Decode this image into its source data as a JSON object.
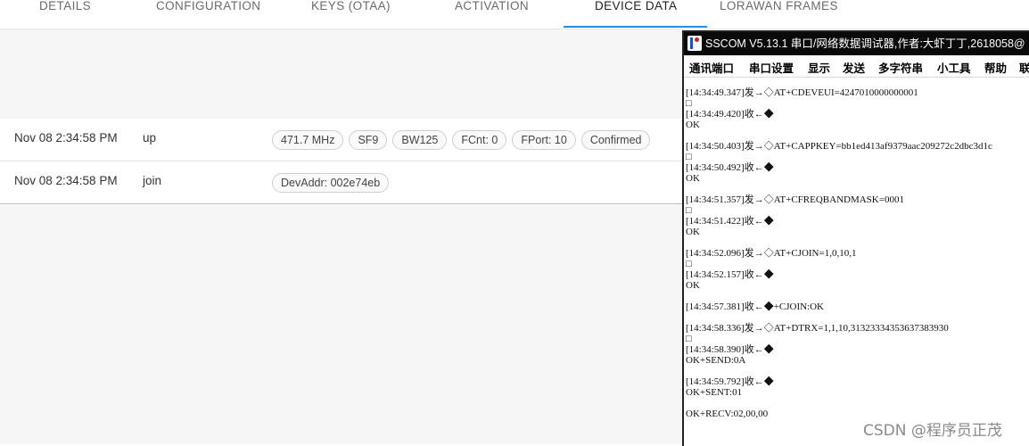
{
  "tabs": [
    {
      "label": "DETAILS"
    },
    {
      "label": "CONFIGURATION"
    },
    {
      "label": "KEYS (OTAA)"
    },
    {
      "label": "ACTIVATION"
    },
    {
      "label": "DEVICE DATA"
    },
    {
      "label": "LORAWAN FRAMES"
    }
  ],
  "active_tab": "DEVICE DATA",
  "accent_color": "#1890ff",
  "frames": [
    {
      "time": "Nov 08 2:34:58 PM",
      "type": "up",
      "tags": [
        "471.7 MHz",
        "SF9",
        "BW125",
        "FCnt: 0",
        "FPort: 10",
        "Confirmed"
      ]
    },
    {
      "time": "Nov 08 2:34:58 PM",
      "type": "join",
      "tags": [
        "DevAddr: 002e74eb"
      ]
    }
  ],
  "sscom": {
    "title": "SSCOM V5.13.1 串口/网络数据调试器,作者:大虾丁丁,2618058@",
    "menu": [
      "通讯端口",
      "串口设置",
      "显示",
      "发送",
      "多字符串",
      "小工具",
      "帮助",
      "联"
    ],
    "log": [
      "[14:34:49.347]发→◇AT+CDEVEUI=4247010000000001",
      "□",
      "[14:34:49.420]收←◆",
      "OK",
      "",
      "[14:34:50.403]发→◇AT+CAPPKEY=bb1ed413af9379aac209272c2dbc3d1c",
      "□",
      "[14:34:50.492]收←◆",
      "OK",
      "",
      "[14:34:51.357]发→◇AT+CFREQBANDMASK=0001",
      "□",
      "[14:34:51.422]收←◆",
      "OK",
      "",
      "[14:34:52.096]发→◇AT+CJOIN=1,0,10,1",
      "□",
      "[14:34:52.157]收←◆",
      "OK",
      "",
      "[14:34:57.381]收←◆+CJOIN:OK",
      "",
      "[14:34:58.336]发→◇AT+DTRX=1,1,10,31323334353637383930",
      "□",
      "[14:34:58.390]收←◆",
      "OK+SEND:0A",
      "",
      "[14:34:59.792]收←◆",
      "OK+SENT:01",
      "",
      "OK+RECV:02,00,00"
    ]
  },
  "watermark": "CSDN @程序员正茂"
}
